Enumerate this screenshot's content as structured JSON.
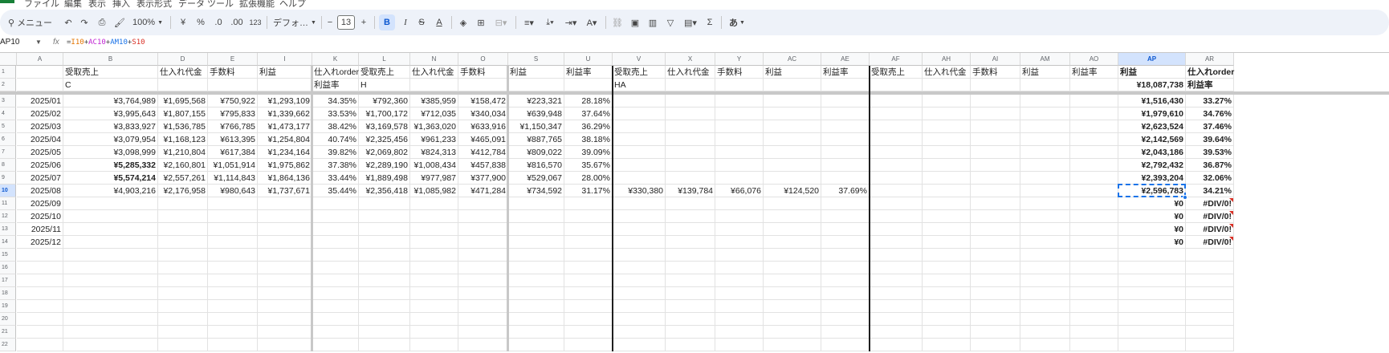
{
  "menu": [
    "ファイル",
    "編集",
    "表示",
    "挿入",
    "表示形式",
    "データ",
    "ツール",
    "拡張機能",
    "ヘルプ"
  ],
  "toolbar": {
    "menu_search": "メニュー",
    "zoom": "100%",
    "currency": "¥",
    "percent": "%",
    "decimal_dec": ".0",
    "decimal_inc": ".00",
    "number_format": "123",
    "font": "デフォ…",
    "font_size": "13",
    "bold": "B",
    "italic": "I",
    "underline": "A",
    "sigma": "Σ",
    "input_tool": "あ"
  },
  "formula_bar": {
    "name_box": "AP10",
    "fx": "fx",
    "formula_prefix": "=",
    "ref1": "I10",
    "ref2": "AC10",
    "ref3": "AM10",
    "ref4": "S10",
    "op": "+"
  },
  "columns": [
    "A",
    "B",
    "D",
    "E",
    "I",
    "K",
    "L",
    "N",
    "O",
    "S",
    "U",
    "V",
    "X",
    "Y",
    "AC",
    "AE",
    "AF",
    "AH",
    "AI",
    "AM",
    "AO",
    "AP",
    "AR"
  ],
  "rows": [
    [
      "",
      "受取売上",
      "仕入れ代金",
      "手数料",
      "利益",
      "仕入れorder",
      "受取売上",
      "仕入れ代金",
      "手数料",
      "利益",
      "利益率",
      "受取売上",
      "仕入れ代金",
      "手数料",
      "利益",
      "利益率",
      "受取売上",
      "仕入れ代金",
      "手数料",
      "利益",
      "利益率",
      "利益",
      "仕入れorder"
    ],
    [
      "",
      "C",
      "",
      "",
      "",
      "利益率",
      "H",
      "",
      "",
      "",
      "",
      "HA",
      "",
      "",
      "",
      "",
      "",
      "",
      "",
      "",
      "",
      "¥18,087,738",
      "利益率"
    ],
    [
      "2025/01",
      "¥3,764,989",
      "¥1,695,568",
      "¥750,922",
      "¥1,293,109",
      "34.35%",
      "¥792,360",
      "¥385,959",
      "¥158,472",
      "¥223,321",
      "28.18%",
      "",
      "",
      "",
      "",
      "",
      "",
      "",
      "",
      "",
      "",
      "¥1,516,430",
      "33.27%"
    ],
    [
      "2025/02",
      "¥3,995,643",
      "¥1,807,155",
      "¥795,833",
      "¥1,339,662",
      "33.53%",
      "¥1,700,172",
      "¥712,035",
      "¥340,034",
      "¥639,948",
      "37.64%",
      "",
      "",
      "",
      "",
      "",
      "",
      "",
      "",
      "",
      "",
      "¥1,979,610",
      "34.76%"
    ],
    [
      "2025/03",
      "¥3,833,927",
      "¥1,536,785",
      "¥766,785",
      "¥1,473,177",
      "38.42%",
      "¥3,169,578",
      "¥1,363,020",
      "¥633,916",
      "¥1,150,347",
      "36.29%",
      "",
      "",
      "",
      "",
      "",
      "",
      "",
      "",
      "",
      "",
      "¥2,623,524",
      "37.46%"
    ],
    [
      "2025/04",
      "¥3,079,954",
      "¥1,168,123",
      "¥613,395",
      "¥1,254,804",
      "40.74%",
      "¥2,325,456",
      "¥961,233",
      "¥465,091",
      "¥887,765",
      "38.18%",
      "",
      "",
      "",
      "",
      "",
      "",
      "",
      "",
      "",
      "",
      "¥2,142,569",
      "39.64%"
    ],
    [
      "2025/05",
      "¥3,098,999",
      "¥1,210,804",
      "¥617,384",
      "¥1,234,164",
      "39.82%",
      "¥2,069,802",
      "¥824,313",
      "¥412,784",
      "¥809,022",
      "39.09%",
      "",
      "",
      "",
      "",
      "",
      "",
      "",
      "",
      "",
      "",
      "¥2,043,186",
      "39.53%"
    ],
    [
      "2025/06",
      "¥5,285,332",
      "¥2,160,801",
      "¥1,051,914",
      "¥1,975,862",
      "37.38%",
      "¥2,289,190",
      "¥1,008,434",
      "¥457,838",
      "¥816,570",
      "35.67%",
      "",
      "",
      "",
      "",
      "",
      "",
      "",
      "",
      "",
      "",
      "¥2,792,432",
      "36.87%"
    ],
    [
      "2025/07",
      "¥5,574,214",
      "¥2,557,261",
      "¥1,114,843",
      "¥1,864,136",
      "33.44%",
      "¥1,889,498",
      "¥977,987",
      "¥377,900",
      "¥529,067",
      "28.00%",
      "",
      "",
      "",
      "",
      "",
      "",
      "",
      "",
      "",
      "",
      "¥2,393,204",
      "32.06%"
    ],
    [
      "2025/08",
      "¥4,903,216",
      "¥2,176,958",
      "¥980,643",
      "¥1,737,671",
      "35.44%",
      "¥2,356,418",
      "¥1,085,982",
      "¥471,284",
      "¥734,592",
      "31.17%",
      "¥330,380",
      "¥139,784",
      "¥66,076",
      "¥124,520",
      "37.69%",
      "",
      "",
      "",
      "",
      "",
      "¥2,596,783",
      "34.21%"
    ],
    [
      "2025/09",
      "",
      "",
      "",
      "",
      "",
      "",
      "",
      "",
      "",
      "",
      "",
      "",
      "",
      "",
      "",
      "",
      "",
      "",
      "",
      "",
      "¥0",
      "#DIV/0!"
    ],
    [
      "2025/10",
      "",
      "",
      "",
      "",
      "",
      "",
      "",
      "",
      "",
      "",
      "",
      "",
      "",
      "",
      "",
      "",
      "",
      "",
      "",
      "",
      "¥0",
      "#DIV/0!"
    ],
    [
      "2025/11",
      "",
      "",
      "",
      "",
      "",
      "",
      "",
      "",
      "",
      "",
      "",
      "",
      "",
      "",
      "",
      "",
      "",
      "",
      "",
      "",
      "¥0",
      "#DIV/0!"
    ],
    [
      "2025/12",
      "",
      "",
      "",
      "",
      "",
      "",
      "",
      "",
      "",
      "",
      "",
      "",
      "",
      "",
      "",
      "",
      "",
      "",
      "",
      "",
      "¥0",
      "#DIV/0!"
    ],
    [
      "",
      "",
      "",
      "",
      "",
      "",
      "",
      "",
      "",
      "",
      "",
      "",
      "",
      "",
      "",
      "",
      "",
      "",
      "",
      "",
      "",
      "",
      ""
    ],
    [
      "",
      "",
      "",
      "",
      "",
      "",
      "",
      "",
      "",
      "",
      "",
      "",
      "",
      "",
      "",
      "",
      "",
      "",
      "",
      "",
      "",
      "",
      ""
    ],
    [
      "",
      "",
      "",
      "",
      "",
      "",
      "",
      "",
      "",
      "",
      "",
      "",
      "",
      "",
      "",
      "",
      "",
      "",
      "",
      "",
      "",
      "",
      ""
    ],
    [
      "",
      "",
      "",
      "",
      "",
      "",
      "",
      "",
      "",
      "",
      "",
      "",
      "",
      "",
      "",
      "",
      "",
      "",
      "",
      "",
      "",
      "",
      ""
    ],
    [
      "",
      "",
      "",
      "",
      "",
      "",
      "",
      "",
      "",
      "",
      "",
      "",
      "",
      "",
      "",
      "",
      "",
      "",
      "",
      "",
      "",
      "",
      ""
    ],
    [
      "",
      "",
      "",
      "",
      "",
      "",
      "",
      "",
      "",
      "",
      "",
      "",
      "",
      "",
      "",
      "",
      "",
      "",
      "",
      "",
      "",
      "",
      ""
    ],
    [
      "",
      "",
      "",
      "",
      "",
      "",
      "",
      "",
      "",
      "",
      "",
      "",
      "",
      "",
      "",
      "",
      "",
      "",
      "",
      "",
      "",
      "",
      ""
    ],
    [
      "",
      "",
      "",
      "",
      "",
      "",
      "",
      "",
      "",
      "",
      "",
      "",
      "",
      "",
      "",
      "",
      "",
      "",
      "",
      "",
      "",
      "",
      ""
    ]
  ],
  "row_numbers": [
    "1",
    "2",
    "3",
    "4",
    "5",
    "6",
    "7",
    "8",
    "9",
    "10",
    "11",
    "12",
    "13",
    "14",
    "15",
    "16",
    "17",
    "18",
    "19",
    "20",
    "21",
    "22"
  ],
  "bold_cells": [
    "7-1",
    "8-1",
    "2-21",
    "3-21",
    "4-21",
    "5-21",
    "6-21",
    "7-21",
    "8-21",
    "9-21",
    "10-21",
    "11-21",
    "12-21",
    "13-21",
    "1-21",
    "0-21",
    "0-22",
    "1-22",
    "2-22",
    "3-22",
    "4-22",
    "5-22",
    "6-22",
    "7-22",
    "8-22",
    "9-22",
    "10-22",
    "11-22",
    "12-22",
    "13-22"
  ],
  "selected_cell": "AP10",
  "selected_column": "AP",
  "selected_row": "10"
}
